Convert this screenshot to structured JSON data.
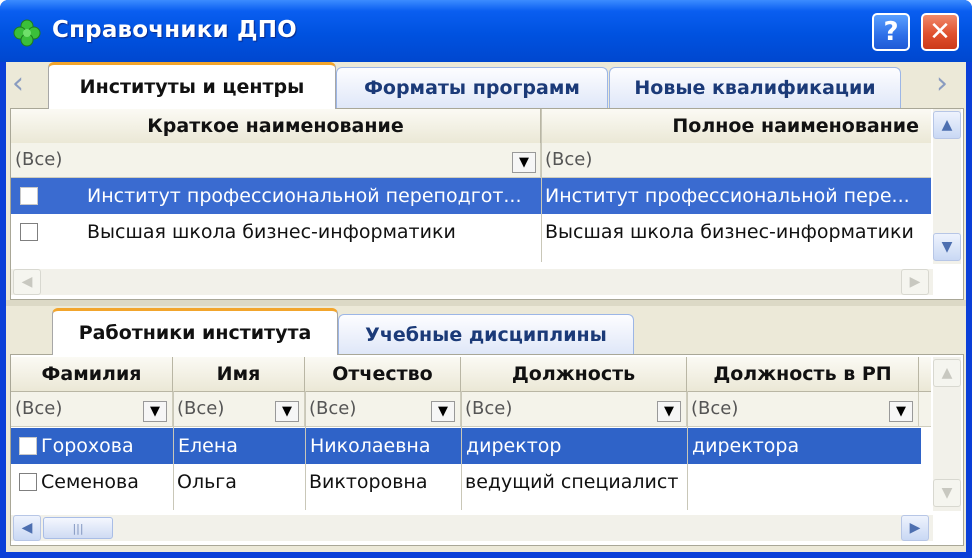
{
  "window": {
    "title": "Справочники ДПО",
    "help_label": "?",
    "close_label": "✕",
    "icon": "clover-icon"
  },
  "top_tabs": [
    {
      "label": "Институты и центры",
      "active": true
    },
    {
      "label": "Форматы программ",
      "active": false
    },
    {
      "label": "Новые квалификации",
      "active": false
    }
  ],
  "top_grid": {
    "columns": [
      "Краткое наименование",
      "Полное наименование"
    ],
    "filter_value": "(Все)",
    "rows": [
      {
        "short": "Институт профессиональной переподгот...",
        "full": "Институт профессиональной пере...",
        "selected": true
      },
      {
        "short": "Высшая школа бизнес-информатики",
        "full": "Высшая школа бизнес-информатики",
        "selected": false
      }
    ]
  },
  "bottom_tabs": [
    {
      "label": "Работники института",
      "active": true
    },
    {
      "label": "Учебные дисциплины",
      "active": false
    }
  ],
  "bottom_grid": {
    "columns": [
      "Фамилия",
      "Имя",
      "Отчество",
      "Должность",
      "Должность в РП"
    ],
    "filter_value": "(Все)",
    "rows": [
      {
        "cells": [
          "Горохова",
          "Елена",
          "Николаевна",
          "директор",
          "директора"
        ],
        "selected": true
      },
      {
        "cells": [
          "Семенова",
          "Ольга",
          "Викторовна",
          "ведущий специалист",
          ""
        ],
        "selected": false
      }
    ]
  },
  "colors": {
    "title_bar": "#0052e0",
    "selection": "#2f63c8",
    "active_tab_accent": "#f2a52c",
    "client_bg": "#ece9d8"
  }
}
